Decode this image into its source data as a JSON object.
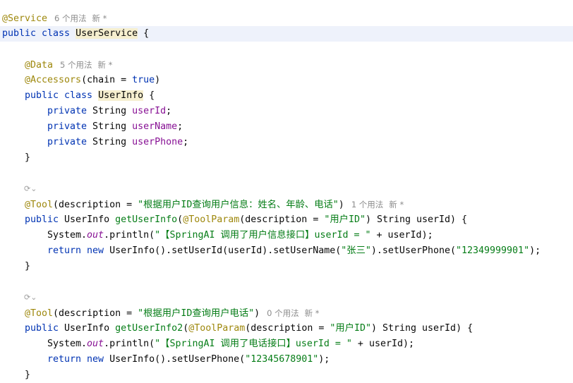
{
  "lines": [
    {
      "indent": 0,
      "tokens": [
        {
          "t": "@Service",
          "c": "ann"
        }
      ],
      "hints": [
        "6 个用法",
        "新 *"
      ]
    },
    {
      "indent": 0,
      "highlighted": true,
      "tokens": [
        {
          "t": "public class ",
          "c": "kw"
        },
        {
          "t": "UserService",
          "c": "cls-hl"
        },
        {
          "t": " {",
          "c": ""
        }
      ]
    },
    {
      "indent": 0,
      "tokens": []
    },
    {
      "indent": 1,
      "tokens": [
        {
          "t": "@Data",
          "c": "ann"
        }
      ],
      "hints": [
        "5 个用法",
        "新 *"
      ]
    },
    {
      "indent": 1,
      "tokens": [
        {
          "t": "@Accessors",
          "c": "ann"
        },
        {
          "t": "(chain = ",
          "c": ""
        },
        {
          "t": "true",
          "c": "kw"
        },
        {
          "t": ")",
          "c": ""
        }
      ]
    },
    {
      "indent": 1,
      "tokens": [
        {
          "t": "public class ",
          "c": "kw"
        },
        {
          "t": "UserInfo",
          "c": "cls-hl"
        },
        {
          "t": " {",
          "c": ""
        }
      ]
    },
    {
      "indent": 2,
      "tokens": [
        {
          "t": "private ",
          "c": "kw"
        },
        {
          "t": "String ",
          "c": ""
        },
        {
          "t": "userId",
          "c": "fld"
        },
        {
          "t": ";",
          "c": ""
        }
      ]
    },
    {
      "indent": 2,
      "tokens": [
        {
          "t": "private ",
          "c": "kw"
        },
        {
          "t": "String ",
          "c": ""
        },
        {
          "t": "userName",
          "c": "fld"
        },
        {
          "t": ";",
          "c": ""
        }
      ]
    },
    {
      "indent": 2,
      "tokens": [
        {
          "t": "private ",
          "c": "kw"
        },
        {
          "t": "String ",
          "c": ""
        },
        {
          "t": "userPhone",
          "c": "fld"
        },
        {
          "t": ";",
          "c": ""
        }
      ]
    },
    {
      "indent": 1,
      "tokens": [
        {
          "t": "}",
          "c": ""
        }
      ]
    },
    {
      "indent": 0,
      "tokens": []
    },
    {
      "indent": 1,
      "tokens": [],
      "gen_icon": true
    },
    {
      "indent": 1,
      "tokens": [
        {
          "t": "@Tool",
          "c": "ann"
        },
        {
          "t": "(description = ",
          "c": ""
        },
        {
          "t": "\"根据用户ID查询用户信息：姓名、年龄、电话\"",
          "c": "str"
        },
        {
          "t": ")",
          "c": ""
        }
      ],
      "hints": [
        "1 个用法",
        "新 *"
      ]
    },
    {
      "indent": 1,
      "tokens": [
        {
          "t": "public ",
          "c": "kw"
        },
        {
          "t": "UserInfo ",
          "c": ""
        },
        {
          "t": "getUserInfo",
          "c": "str"
        },
        {
          "t": "(",
          "c": ""
        },
        {
          "t": "@ToolParam",
          "c": "ann"
        },
        {
          "t": "(description = ",
          "c": ""
        },
        {
          "t": "\"用户ID\"",
          "c": "str"
        },
        {
          "t": ") String userId) {",
          "c": ""
        }
      ]
    },
    {
      "indent": 2,
      "tokens": [
        {
          "t": "System.",
          "c": ""
        },
        {
          "t": "out",
          "c": "ital"
        },
        {
          "t": ".println(",
          "c": ""
        },
        {
          "t": "\"【SpringAI 调用了用户信息接口】userId = \"",
          "c": "str"
        },
        {
          "t": " + userId);",
          "c": ""
        }
      ]
    },
    {
      "indent": 2,
      "tokens": [
        {
          "t": "return new ",
          "c": "kw"
        },
        {
          "t": "UserInfo().setUserId(userId).setUserName(",
          "c": ""
        },
        {
          "t": "\"张三\"",
          "c": "str"
        },
        {
          "t": ").setUserPhone(",
          "c": ""
        },
        {
          "t": "\"12349999901\"",
          "c": "str"
        },
        {
          "t": ");",
          "c": ""
        }
      ]
    },
    {
      "indent": 1,
      "tokens": [
        {
          "t": "}",
          "c": ""
        }
      ]
    },
    {
      "indent": 0,
      "tokens": []
    },
    {
      "indent": 1,
      "tokens": [],
      "gen_icon": true
    },
    {
      "indent": 1,
      "tokens": [
        {
          "t": "@Tool",
          "c": "ann"
        },
        {
          "t": "(description = ",
          "c": ""
        },
        {
          "t": "\"根据用户ID查询用户电话\"",
          "c": "str"
        },
        {
          "t": ")",
          "c": ""
        }
      ],
      "hints": [
        "0 个用法",
        "新 *"
      ]
    },
    {
      "indent": 1,
      "tokens": [
        {
          "t": "public ",
          "c": "kw"
        },
        {
          "t": "UserInfo ",
          "c": ""
        },
        {
          "t": "getUserInfo2",
          "c": "str"
        },
        {
          "t": "(",
          "c": ""
        },
        {
          "t": "@ToolParam",
          "c": "ann"
        },
        {
          "t": "(description = ",
          "c": ""
        },
        {
          "t": "\"用户ID\"",
          "c": "str"
        },
        {
          "t": ") String userId) {",
          "c": ""
        }
      ]
    },
    {
      "indent": 2,
      "tokens": [
        {
          "t": "System.",
          "c": ""
        },
        {
          "t": "out",
          "c": "ital"
        },
        {
          "t": ".println(",
          "c": ""
        },
        {
          "t": "\"【SpringAI 调用了电话接口】userId = \"",
          "c": "str"
        },
        {
          "t": " + userId);",
          "c": ""
        }
      ]
    },
    {
      "indent": 2,
      "tokens": [
        {
          "t": "return new ",
          "c": "kw"
        },
        {
          "t": "UserInfo().setUserPhone(",
          "c": ""
        },
        {
          "t": "\"12345678901\"",
          "c": "str"
        },
        {
          "t": ");",
          "c": ""
        }
      ]
    },
    {
      "indent": 1,
      "tokens": [
        {
          "t": "}",
          "c": ""
        }
      ]
    }
  ],
  "gen_icon_glyph": "⟳⌄",
  "colors": {
    "keyword": "#0033b3",
    "annotation": "#9e880d",
    "string": "#067d17",
    "field": "#871094",
    "hint": "#8c8c8c",
    "current_line": "#eef2fb"
  }
}
